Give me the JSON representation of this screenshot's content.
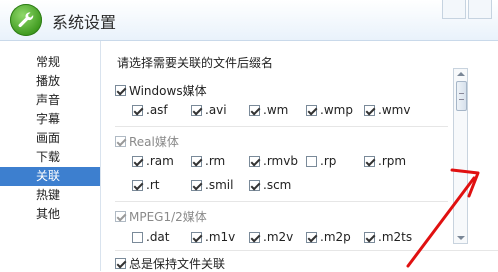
{
  "window": {
    "title": "系统设置",
    "app_icon": "wrench-icon"
  },
  "sidebar": {
    "items": [
      {
        "label": "常规",
        "active": false
      },
      {
        "label": "播放",
        "active": false
      },
      {
        "label": "声音",
        "active": false
      },
      {
        "label": "字幕",
        "active": false
      },
      {
        "label": "画面",
        "active": false
      },
      {
        "label": "下载",
        "active": false
      },
      {
        "label": "关联",
        "active": true
      },
      {
        "label": "热键",
        "active": false
      },
      {
        "label": "其他",
        "active": false
      }
    ],
    "active_color": "#3d7fcf"
  },
  "main": {
    "heading": "请选择需要关联的文件后缀名",
    "groups": [
      {
        "label": "Windows媒体",
        "checked": true,
        "faded": false,
        "options": [
          {
            "label": ".asf",
            "checked": true
          },
          {
            "label": ".avi",
            "checked": true
          },
          {
            "label": ".wm",
            "checked": true
          },
          {
            "label": ".wmp",
            "checked": true
          },
          {
            "label": ".wmv",
            "checked": true
          }
        ]
      },
      {
        "label": "Real媒体",
        "checked": true,
        "faded": true,
        "options": [
          {
            "label": ".ram",
            "checked": true
          },
          {
            "label": ".rm",
            "checked": true
          },
          {
            "label": ".rmvb",
            "checked": true
          },
          {
            "label": ".rp",
            "checked": false
          },
          {
            "label": ".rpm",
            "checked": true
          },
          {
            "label": ".rt",
            "checked": true
          },
          {
            "label": ".smil",
            "checked": true
          },
          {
            "label": ".scm",
            "checked": true
          }
        ]
      },
      {
        "label": "MPEG1/2媒体",
        "checked": true,
        "faded": true,
        "options": [
          {
            "label": ".dat",
            "checked": false
          },
          {
            "label": ".m1v",
            "checked": true
          },
          {
            "label": ".m2v",
            "checked": true
          },
          {
            "label": ".m2p",
            "checked": true
          },
          {
            "label": ".m2ts",
            "checked": true
          }
        ]
      }
    ],
    "keep_association": {
      "label": "总是保持文件关联",
      "checked": true
    }
  },
  "annotation": {
    "arrow_color": "#e01010"
  }
}
